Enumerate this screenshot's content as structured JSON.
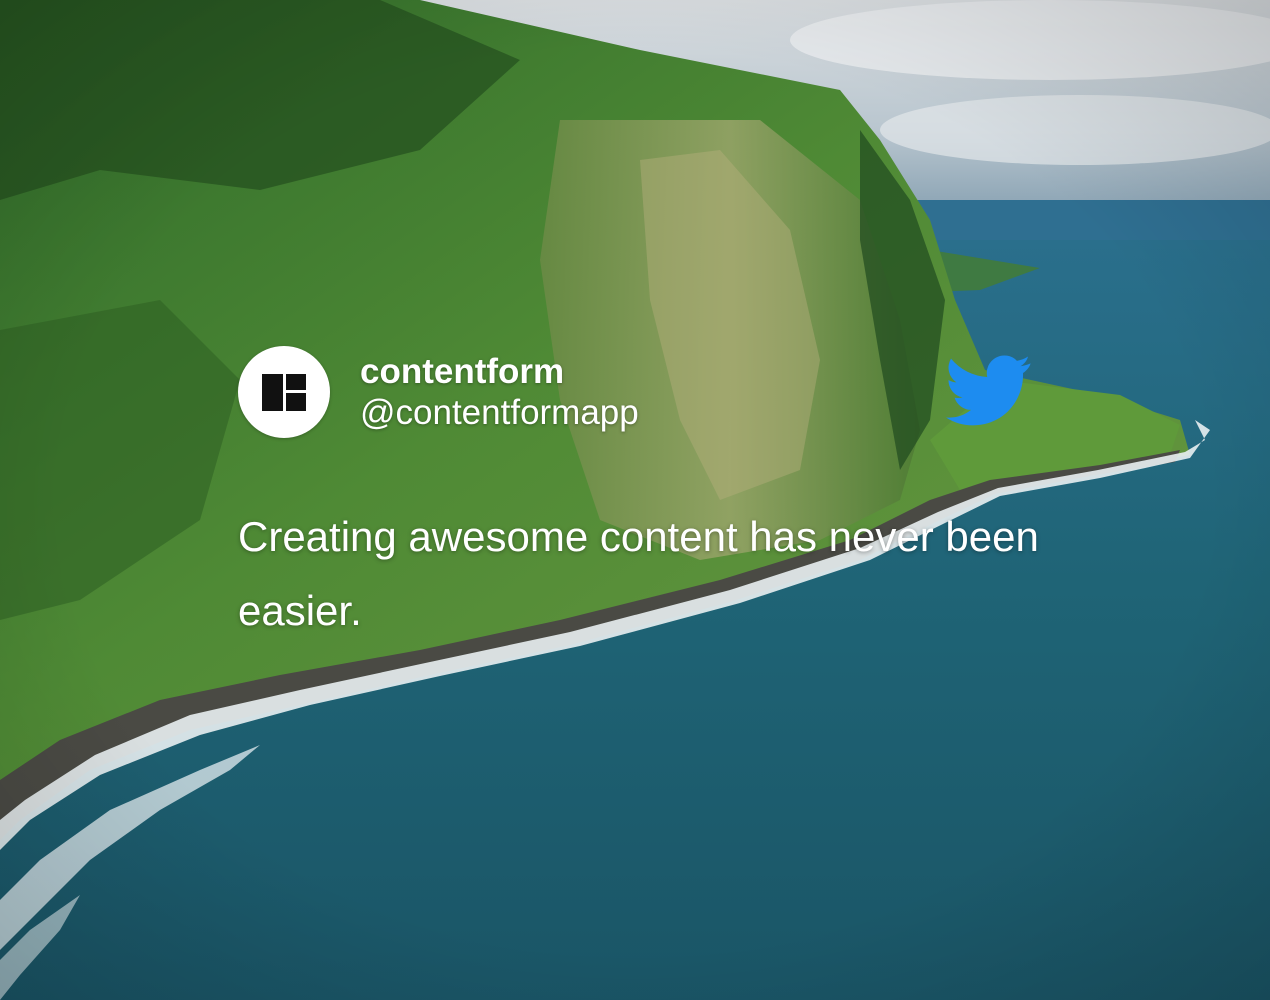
{
  "account": {
    "name": "contentform",
    "handle": "@contentformapp",
    "avatar_icon": "contentform-logo-icon"
  },
  "tweet": {
    "text": "Creating awesome content has never been easier."
  },
  "brand_icon": "twitter-bird-icon",
  "colors": {
    "twitter_blue": "#1d8cf0",
    "text": "#ffffff",
    "avatar_bg": "#ffffff"
  }
}
